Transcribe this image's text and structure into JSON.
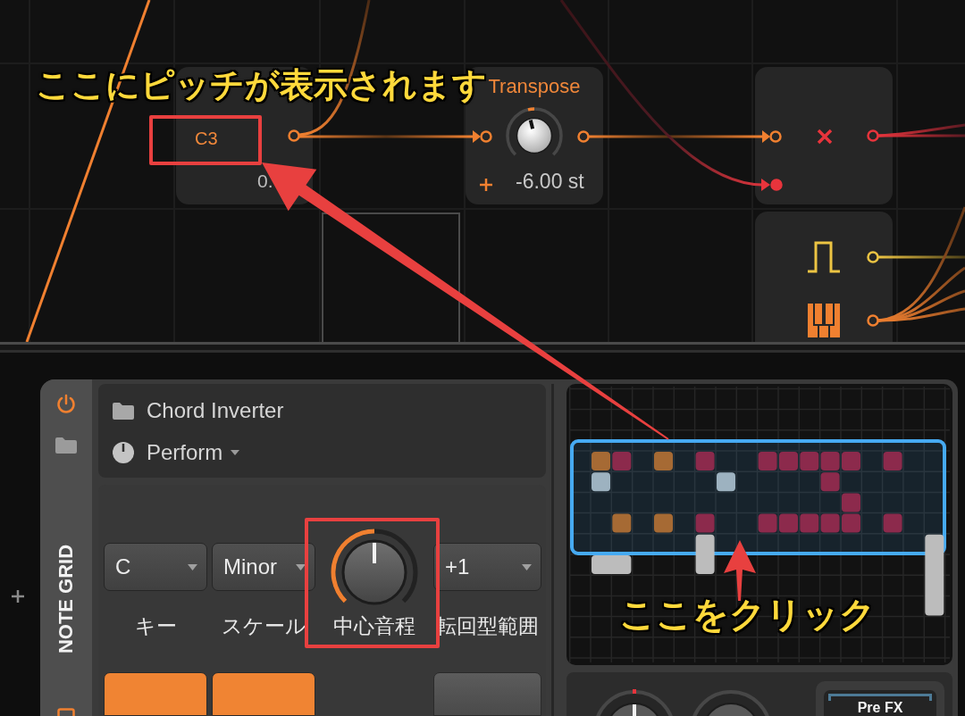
{
  "graph": {
    "nodes": [
      {
        "kind": "pitch",
        "value": "C3",
        "reading": "0."
      },
      {
        "kind": "transpose",
        "title": "Transpose",
        "level": 0.45,
        "reading": "-6.00 st"
      },
      {
        "kind": "multiply"
      },
      {
        "kind": "sources"
      }
    ]
  },
  "device": {
    "power": {
      "on": true
    },
    "type_label": "NOTE GRID",
    "name": "Chord Inverter",
    "preset": "Perform",
    "parameters": [
      {
        "kind": "dropdown",
        "value": "C",
        "label": "キー",
        "button_on": true
      },
      {
        "kind": "dropdown",
        "value": "Minor",
        "label": "スケール",
        "button_on": true
      },
      {
        "kind": "knob",
        "level": 0.5,
        "label": "中心音程"
      },
      {
        "kind": "dropdown",
        "value": "+1",
        "label": "転回型範囲",
        "button_on": false
      }
    ]
  },
  "grid": {
    "modules": [
      {
        "color": "#a66a34"
      },
      {
        "color": "#8c2a4c"
      },
      {
        "color": "#a66a34"
      },
      {
        "color": "#8c2a4c"
      },
      {
        "color": "#8c2a4c"
      },
      {
        "color": "#8c2a4c"
      },
      {
        "color": "#8c2a4c"
      },
      {
        "color": "#8c2a4c"
      },
      {
        "color": "#8c2a4c"
      },
      {
        "color": "#8c2a4c"
      },
      {
        "color": "#9db2c0"
      },
      {
        "color": "#9db2c0"
      },
      {
        "color": "#8c2a4c"
      },
      {
        "color": "#8c2a4c"
      },
      {
        "color": "#a66a34"
      },
      {
        "color": "#a66a34"
      },
      {
        "color": "#8c2a4c"
      },
      {
        "color": "#8c2a4c"
      },
      {
        "color": "#8c2a4c"
      },
      {
        "color": "#8c2a4c"
      },
      {
        "color": "#8c2a4c"
      },
      {
        "color": "#8c2a4c"
      },
      {
        "color": "#8c2a4c"
      },
      {
        "color": "#bcbcbc"
      },
      {
        "color": "#bcbcbc"
      },
      {
        "color": "#bcbcbc"
      }
    ]
  },
  "footer": {
    "knob": {
      "level": 0.5
    },
    "slot_label": "Pre FX"
  },
  "callouts": [
    {
      "text": "ここにピッチが表示されます"
    },
    {
      "text": "ここをクリック"
    }
  ]
}
